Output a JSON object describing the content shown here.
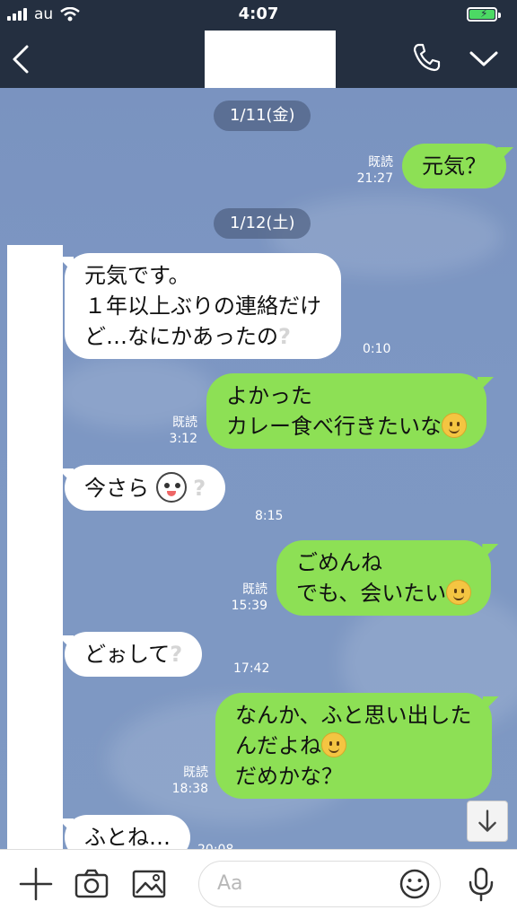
{
  "status_bar": {
    "carrier": "au",
    "time": "4:07",
    "battery": 1.0
  },
  "header": {
    "title": ""
  },
  "date_separators": [
    "1/11(金)",
    "1/12(土)"
  ],
  "messages": [
    {
      "side": "out",
      "lines": [
        "元気？"
      ],
      "read": "既読",
      "time": "21:27"
    },
    {
      "side": "in",
      "lines": [
        "元気です。",
        "１年以上ぶりの連絡だけ",
        "ど…なにかあったの"
      ],
      "time": "0:10"
    },
    {
      "side": "out",
      "lines": [
        "よかった",
        "カレー食べ行きたいな"
      ],
      "read": "既読",
      "time": "3:12"
    },
    {
      "side": "in",
      "lines": [
        "今さら"
      ],
      "time": "8:15"
    },
    {
      "side": "out",
      "lines": [
        "ごめんね",
        "でも、会いたい"
      ],
      "read": "既読",
      "time": "15:39"
    },
    {
      "side": "in",
      "lines": [
        "どぉして"
      ],
      "time": "17:42"
    },
    {
      "side": "out",
      "lines": [
        "なんか、ふと思い出した",
        "んだよね",
        "だめかな？"
      ],
      "read": "既読",
      "time": "18:38"
    },
    {
      "side": "in",
      "lines": [
        "ふとね…"
      ],
      "time": "20:08"
    }
  ],
  "icons": {
    "back": "chevron-left-icon",
    "call": "phone-icon",
    "menu": "chevron-down-icon",
    "plus": "plus-icon",
    "camera": "camera-icon",
    "image": "image-icon",
    "emoji": "smiley-icon",
    "mic": "microphone-icon",
    "scroll": "arrow-down-icon"
  },
  "input": {
    "placeholder": "Aa"
  },
  "colors": {
    "header": "#242f40",
    "chat_bg": "#7d97c3",
    "outgoing": "#8de055",
    "incoming": "#ffffff"
  }
}
